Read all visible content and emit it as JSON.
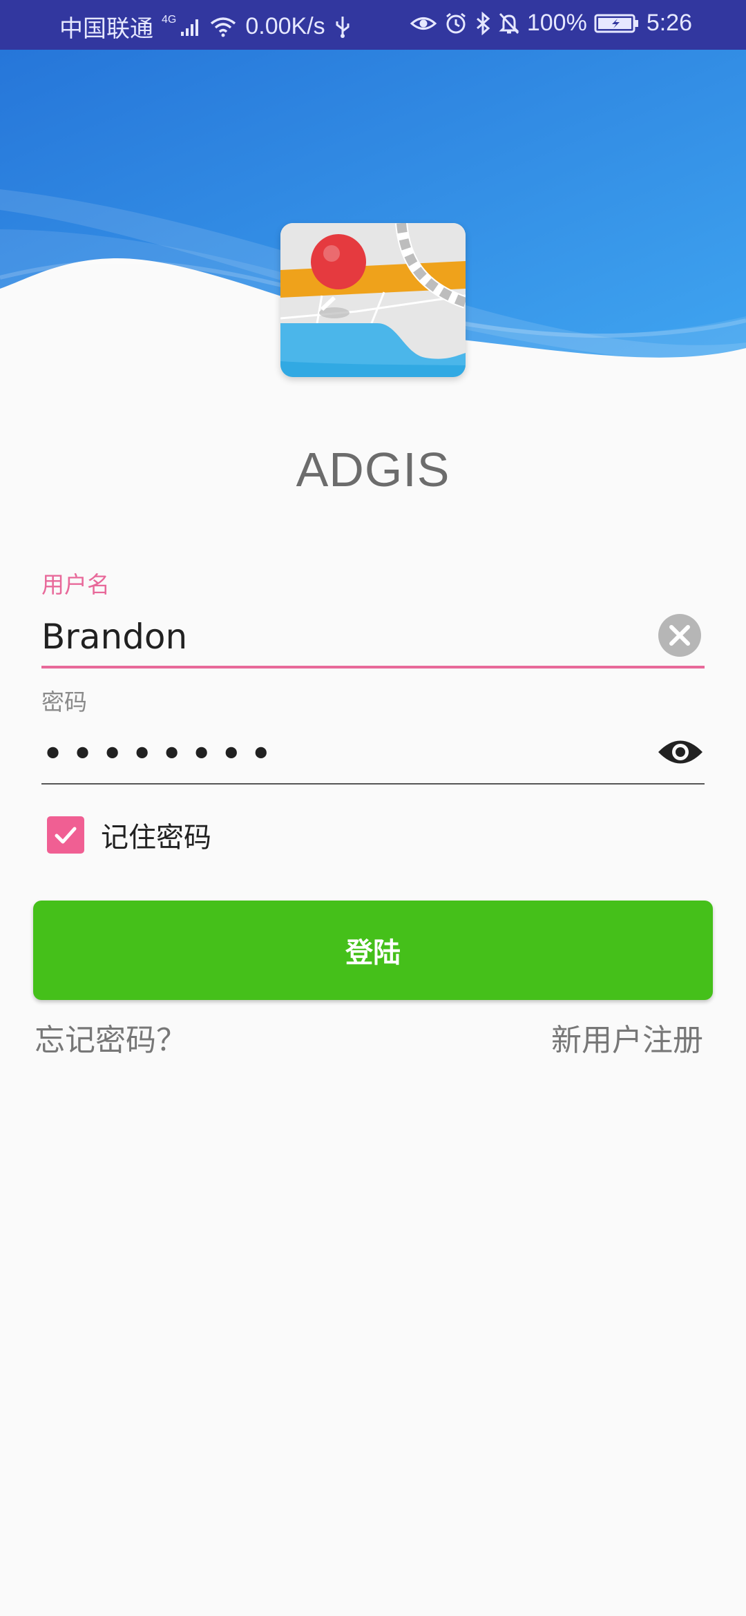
{
  "status_bar": {
    "carrier": "中国联通",
    "network": "4G",
    "speed": "0.00K/s",
    "battery": "100%",
    "time": "5:26"
  },
  "app": {
    "title": "ADGIS"
  },
  "login_form": {
    "username_label": "用户名",
    "username_value": "Brandon",
    "password_label": "密码",
    "password_value": "••••••••",
    "remember_label": "记住密码",
    "remember_checked": true,
    "login_button": "登陆",
    "forgot_link": "忘记密码？",
    "register_link": "新用户注册"
  },
  "colors": {
    "status_bar": "#32379f",
    "header_blue": "#2f8fe6",
    "accent_pink": "#e8699a",
    "checkbox_pink": "#f05f93",
    "login_green": "#45c01a",
    "title_gray": "#6c6c6c"
  },
  "icons": {
    "status_left": [
      "signal-icon",
      "wifi-icon",
      "usb-icon"
    ],
    "status_right": [
      "eye-comfort-icon",
      "alarm-icon",
      "bluetooth-icon",
      "mute-bell-icon",
      "battery-charging-icon"
    ],
    "form": [
      "clear-text-icon",
      "show-password-icon",
      "checkmark-icon"
    ]
  }
}
